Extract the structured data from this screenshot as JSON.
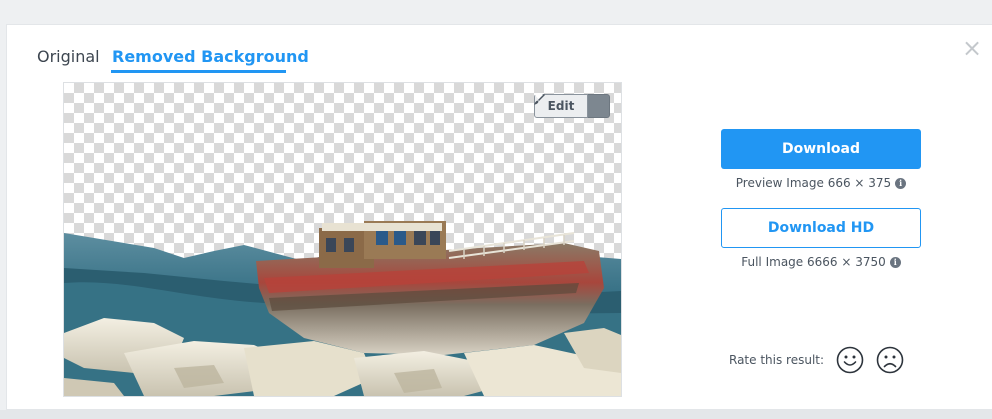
{
  "tabs": {
    "original": "Original",
    "removed": "Removed Background"
  },
  "preview": {
    "edit_label": "Edit",
    "edit_icon": "brush-icon",
    "caret_icon": "caret-down-icon",
    "image_subject": "boat-cutout"
  },
  "download": {
    "label": "Download",
    "info": "Preview Image 666 × 375",
    "hd_label": "Download HD",
    "hd_info": "Full Image 6666 × 3750",
    "info_icon": "info-icon"
  },
  "rating": {
    "label": "Rate this result:",
    "positive_icon": "smile-icon",
    "negative_icon": "frown-icon"
  },
  "close_icon": "close-icon",
  "colors": {
    "accent": "#2196f3",
    "text": "#3d4650",
    "background": "#eef0f2"
  }
}
